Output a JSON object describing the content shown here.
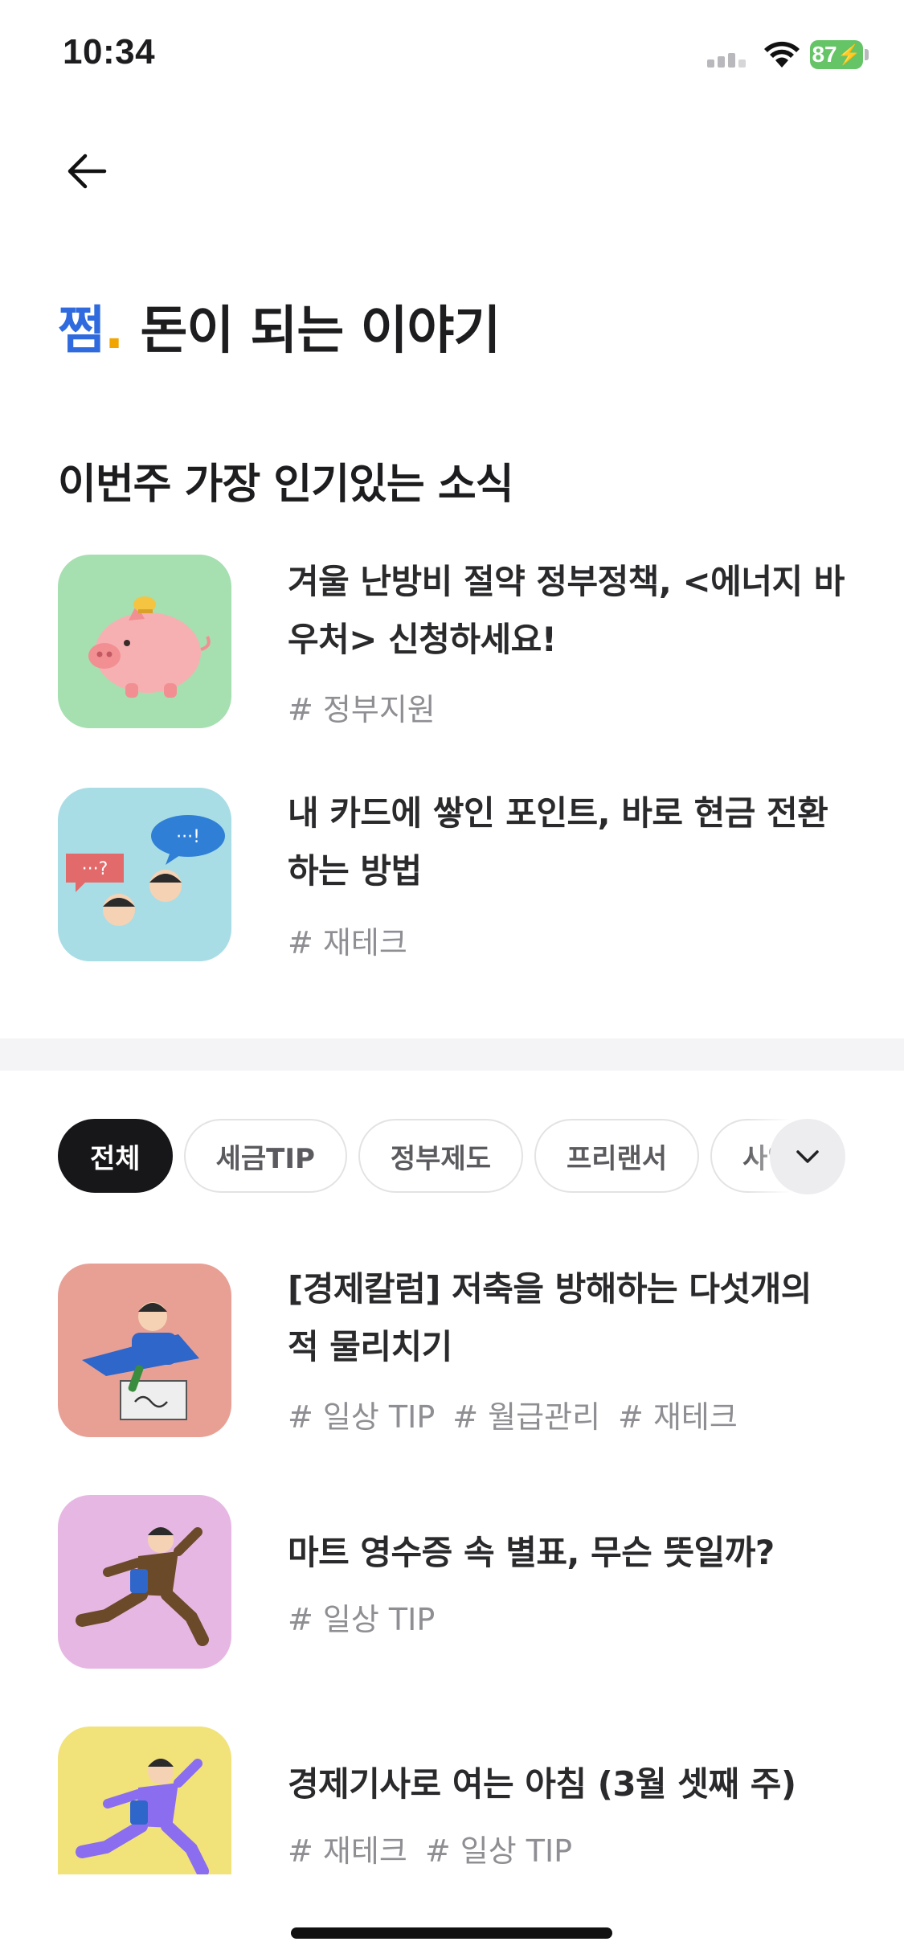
{
  "status_bar": {
    "time": "10:34",
    "battery": "87"
  },
  "header": {
    "brand": "쩜",
    "dot": ".",
    "title_rest": " 돈이 되는 이야기"
  },
  "popular": {
    "section_title": "이번주 가장 인기있는 소식",
    "items": [
      {
        "title": "겨울 난방비 절약 정부정책, <에너지 바우처> 신청하세요!",
        "tags": [
          "# 정부지원"
        ],
        "thumb_color": "#a6dfb0",
        "image": "piggy-bank-illustration"
      },
      {
        "title": "내 카드에 쌓인 포인트, 바로 현금 전환 하는 방법",
        "tags": [
          "# 재테크"
        ],
        "thumb_color": "#a8dde6",
        "image": "chat-bubbles-illustration"
      }
    ]
  },
  "chips": {
    "items": [
      "전체",
      "세금TIP",
      "정부제도",
      "프리랜서",
      "사업"
    ],
    "active_index": 0
  },
  "articles": [
    {
      "title": "[경제칼럼] 저축을 방해하는 다섯개의 적 물리치기",
      "tags": [
        "# 일상 TIP",
        "# 월급관리",
        "# 재테크"
      ],
      "thumb_color": "#e8a095",
      "image": "person-writing-illustration"
    },
    {
      "title": "마트 영수증 속 별표, 무슨 뜻일까?",
      "tags": [
        "# 일상 TIP"
      ],
      "thumb_color": "#e7b7e4",
      "image": "running-man-illustration"
    },
    {
      "title": "경제기사로 여는 아침 (3월 셋째 주)",
      "tags": [
        "# 재테크",
        "# 일상 TIP"
      ],
      "thumb_color": "#f2e27a",
      "image": "running-man-purple-illustration"
    }
  ],
  "colors": {
    "brand": "#2f6bde",
    "brand_dot": "#f0a500",
    "battery": "#65c466",
    "active_chip": "#17171a"
  }
}
